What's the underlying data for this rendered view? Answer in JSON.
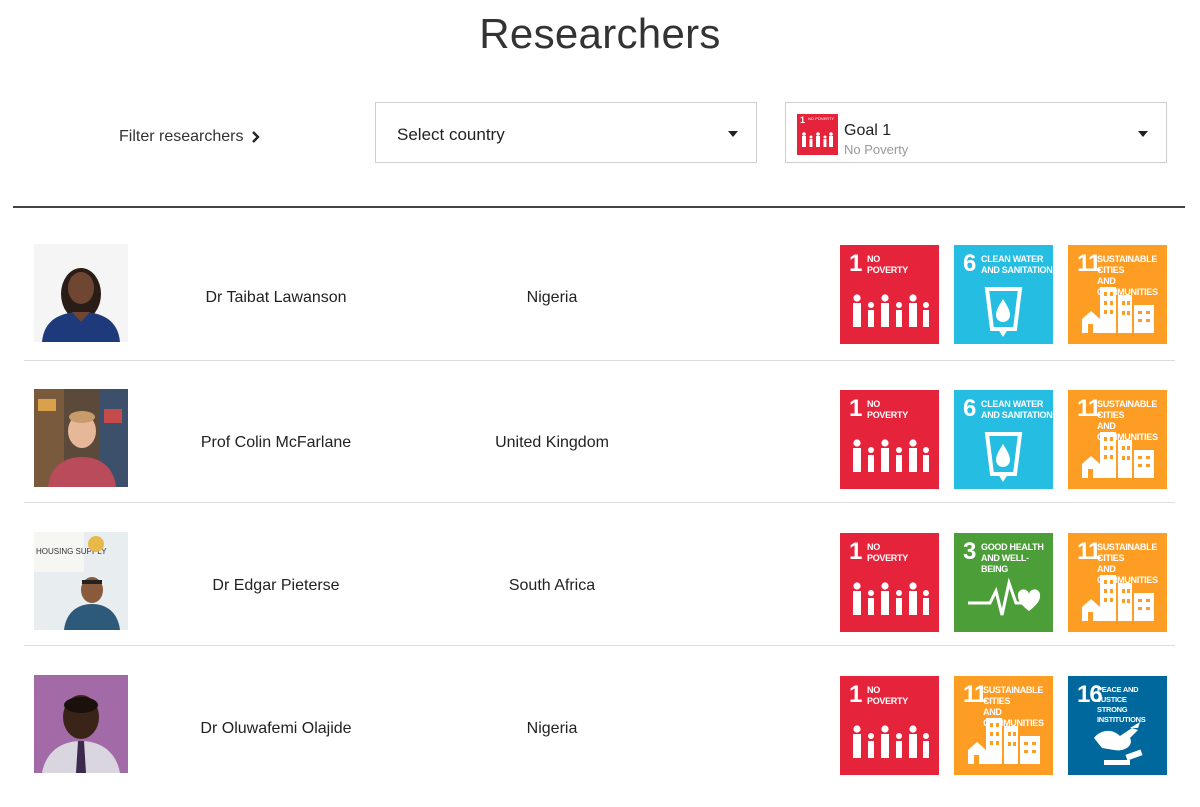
{
  "page": {
    "title": "Researchers"
  },
  "filters": {
    "label": "Filter researchers",
    "country_select": {
      "value": "Select country"
    },
    "goal_select": {
      "thumb_number": "1",
      "thumb_text": "NO POVERTY",
      "value": "Goal 1",
      "sub": "No Poverty"
    }
  },
  "sdg_goals": {
    "1": {
      "number": "1",
      "label": "NO\nPOVERTY",
      "color": "#e5243b",
      "icon": "no-poverty"
    },
    "3": {
      "number": "3",
      "label": "GOOD HEALTH\nAND WELL-BEING",
      "color": "#4c9f38",
      "icon": "good-health"
    },
    "6": {
      "number": "6",
      "label": "CLEAN WATER\nAND SANITATION",
      "color": "#26bde2",
      "icon": "clean-water"
    },
    "11": {
      "number": "11",
      "label": "SUSTAINABLE CITIES\nAND COMMUNITIES",
      "color": "#fd9d24",
      "icon": "sustainable-cities"
    },
    "16": {
      "number": "16",
      "label": "PEACE AND JUSTICE\nSTRONG INSTITUTIONS",
      "color": "#00689d",
      "icon": "peace-justice"
    }
  },
  "researchers": [
    {
      "name": "Dr Taibat Lawanson",
      "country": "Nigeria",
      "goals": [
        "1",
        "6",
        "11"
      ]
    },
    {
      "name": "Prof Colin McFarlane",
      "country": "United Kingdom",
      "goals": [
        "1",
        "6",
        "11"
      ]
    },
    {
      "name": "Dr Edgar Pieterse",
      "country": "South Africa",
      "goals": [
        "1",
        "3",
        "11"
      ]
    },
    {
      "name": "Dr Oluwafemi Olajide",
      "country": "Nigeria",
      "goals": [
        "1",
        "11",
        "16"
      ]
    }
  ]
}
